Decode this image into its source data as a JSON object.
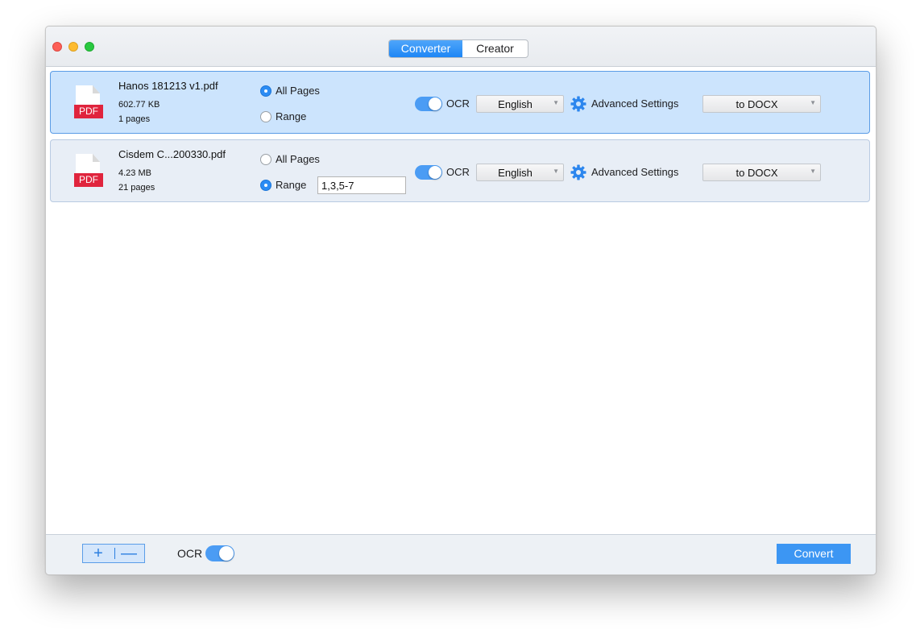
{
  "titlebar": {
    "tabs": [
      {
        "label": "Converter",
        "active": true
      },
      {
        "label": "Creator",
        "active": false
      }
    ]
  },
  "files": [
    {
      "icon_label": "PDF",
      "name": "Hanos 181213 v1.pdf",
      "size": "602.77 KB",
      "pages": "1 pages",
      "all_pages_label": "All Pages",
      "range_label": "Range",
      "selected_option": "All Pages",
      "range_value": "",
      "ocr_label": "OCR",
      "ocr_enabled": true,
      "language": "English",
      "advanced_label": "Advanced Settings",
      "format": "to DOCX",
      "selected": true
    },
    {
      "icon_label": "PDF",
      "name": "Cisdem C...200330.pdf",
      "size": "4.23 MB",
      "pages": "21 pages",
      "all_pages_label": "All Pages",
      "range_label": "Range",
      "selected_option": "Range",
      "range_value": "1,3,5-7",
      "ocr_label": "OCR",
      "ocr_enabled": true,
      "language": "English",
      "advanced_label": "Advanced Settings",
      "format": "to DOCX",
      "selected": false
    }
  ],
  "footer": {
    "add_symbol": "+",
    "remove_symbol": "—",
    "ocr_label": "OCR",
    "ocr_enabled": true,
    "convert_label": "Convert"
  },
  "colors": {
    "accent": "#2c8cf4",
    "selected_row": "#cce4fd",
    "row": "#e8eef6",
    "pdf_red": "#e0243d"
  },
  "icons": [
    "pdf-file-icon",
    "gear-icon",
    "chevron-down-icon"
  ]
}
